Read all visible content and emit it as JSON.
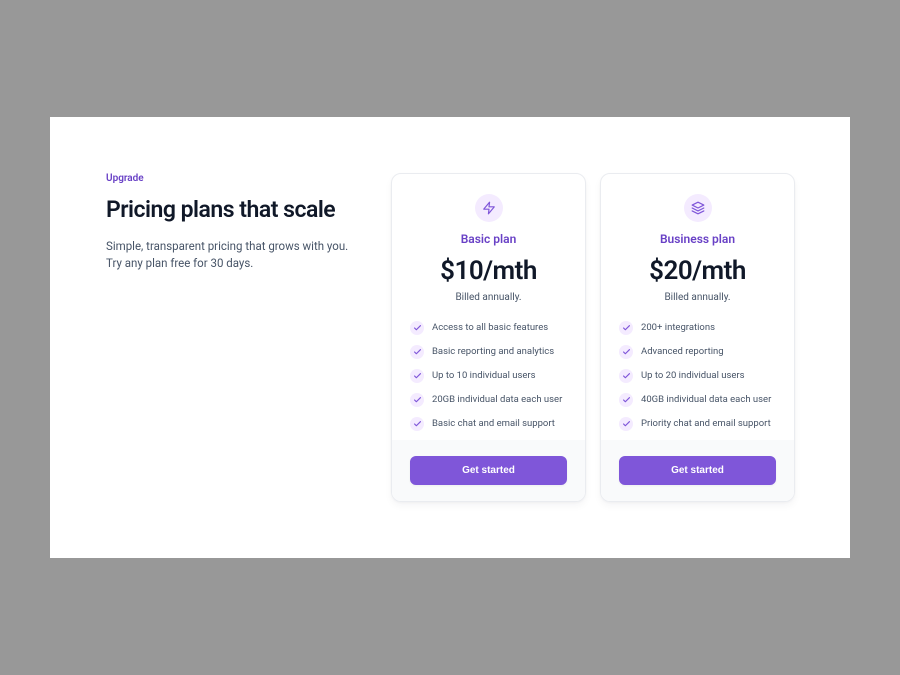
{
  "header": {
    "subheading": "Upgrade",
    "heading": "Pricing plans that scale",
    "supporting_text": "Simple, transparent pricing that grows with you. Try any plan free for 30 days."
  },
  "plans": {
    "basic": {
      "name": "Basic plan",
      "price": "$10/mth",
      "billing": "Billed annually.",
      "features": [
        "Access to all basic features",
        "Basic reporting and analytics",
        "Up to 10 individual users",
        "20GB individual data each user",
        "Basic chat and email support"
      ],
      "cta_label": "Get started"
    },
    "business": {
      "name": "Business plan",
      "price": "$20/mth",
      "billing": "Billed annually.",
      "features": [
        "200+ integrations",
        "Advanced reporting",
        "Up to 20 individual users",
        "40GB individual data each user",
        "Priority chat and email support"
      ],
      "cta_label": "Get started"
    }
  }
}
